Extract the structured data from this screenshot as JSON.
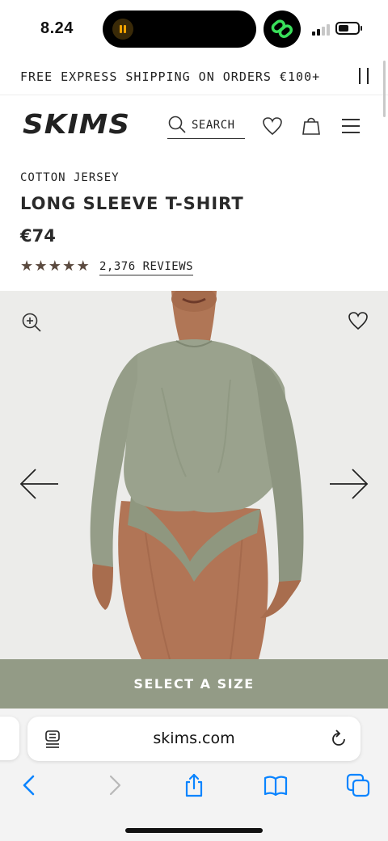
{
  "status_bar": {
    "time": "8.24",
    "signal_bars_active": 2,
    "signal_bars_total": 4
  },
  "announcement": {
    "text": "FREE EXPRESS SHIPPING ON ORDERS €100+",
    "pause_icon": "pause-icon"
  },
  "header": {
    "logo": "SKIMS",
    "search_label": "SEARCH",
    "icons": [
      "search-icon",
      "heart-icon",
      "bag-icon",
      "menu-icon"
    ]
  },
  "product": {
    "category": "COTTON JERSEY",
    "title": "LONG SLEEVE T-SHIRT",
    "price": "€74",
    "rating": 5,
    "reviews_label": "2,376 REVIEWS"
  },
  "gallery": {
    "icons": [
      "zoom-in-icon",
      "heart-icon",
      "arrow-left-icon",
      "arrow-right-icon"
    ]
  },
  "cta": {
    "label": "SELECT A SIZE"
  },
  "browser": {
    "url": "skims.com",
    "icons": [
      "page-settings-icon",
      "reload-icon",
      "back-icon",
      "forward-icon",
      "share-icon",
      "bookmarks-icon",
      "tabs-icon"
    ]
  },
  "colors": {
    "cta_background": "#939b86",
    "star": "#5b4a3f",
    "ios_blue": "#0a84ff"
  }
}
